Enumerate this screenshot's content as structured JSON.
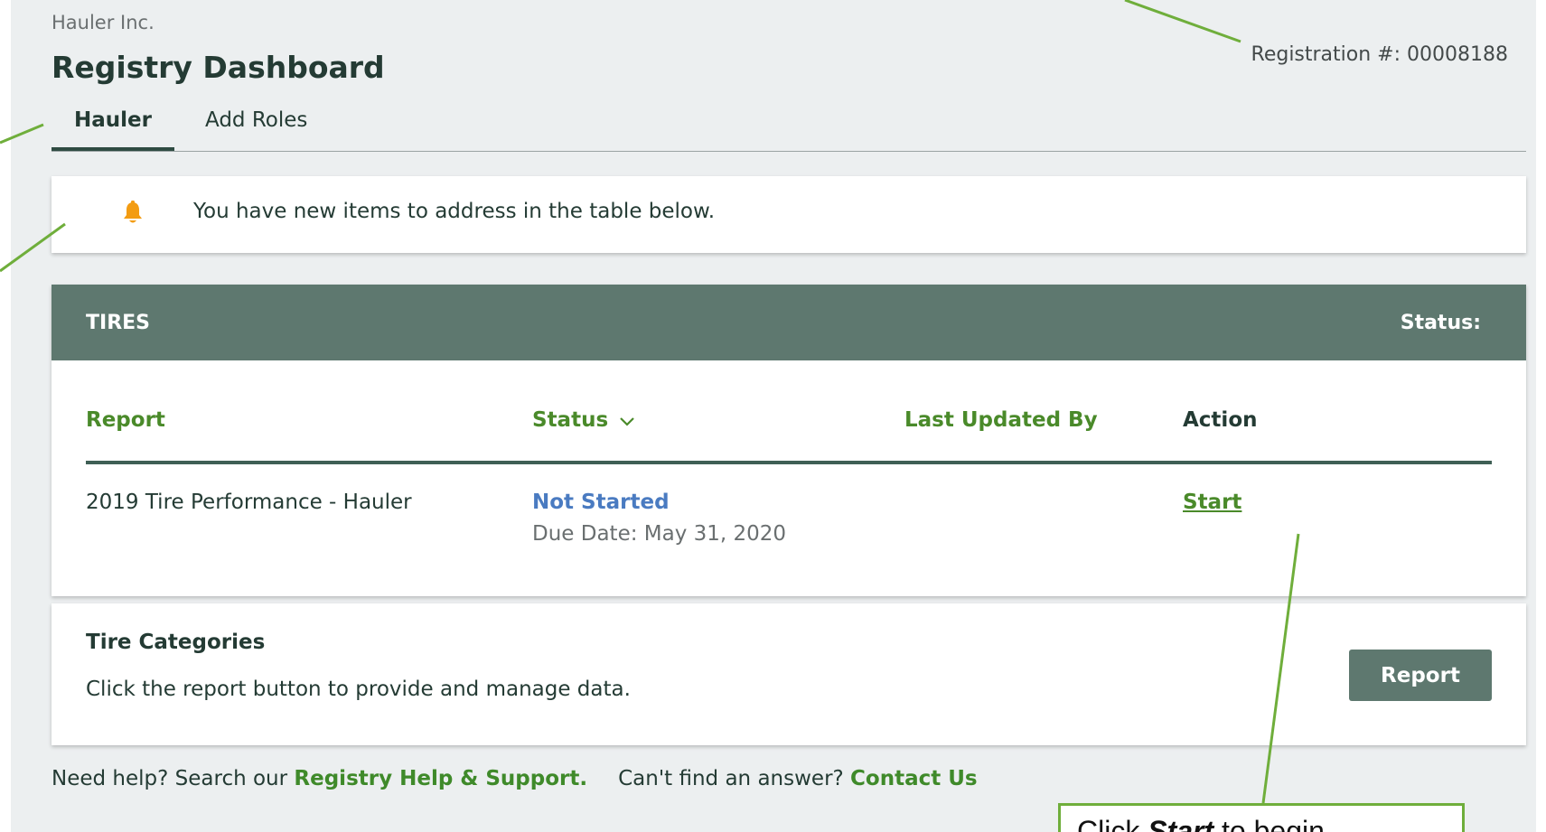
{
  "header": {
    "company": "Hauler Inc.",
    "title": "Registry Dashboard",
    "registration": "Registration #: 00008188"
  },
  "tabs": [
    {
      "label": "Hauler",
      "active": true
    },
    {
      "label": "Add Roles",
      "active": false
    }
  ],
  "notice": {
    "icon": "bell-icon",
    "text": "You have new items to address in the table below."
  },
  "tires": {
    "title": "TIRES",
    "status_label": "Status:",
    "columns": [
      "Report",
      "Status",
      "Last Updated By",
      "Action"
    ],
    "rows": [
      {
        "report": "2019 Tire Performance - Hauler",
        "status": "Not Started",
        "due": "Due Date:  May 31, 2020",
        "last_updated_by": "",
        "action": "Start"
      }
    ]
  },
  "categories": {
    "title": "Tire Categories",
    "description": "Click the report button to provide and manage data.",
    "button": "Report"
  },
  "footer": {
    "help_prefix": "Need help? Search our ",
    "help_link": "Registry Help & Support.",
    "answer_prefix": "Can't find an answer? ",
    "contact_link": "Contact Us"
  },
  "callout": {
    "prefix": "Click ",
    "emphasis": "Start",
    "suffix": " to begin"
  },
  "colors": {
    "header_bar": "#5e786f",
    "link_green": "#4a8a2a",
    "status_blue": "#4a7bc1",
    "bell_orange": "#f39c12",
    "callout_green": "#6fae3b"
  }
}
